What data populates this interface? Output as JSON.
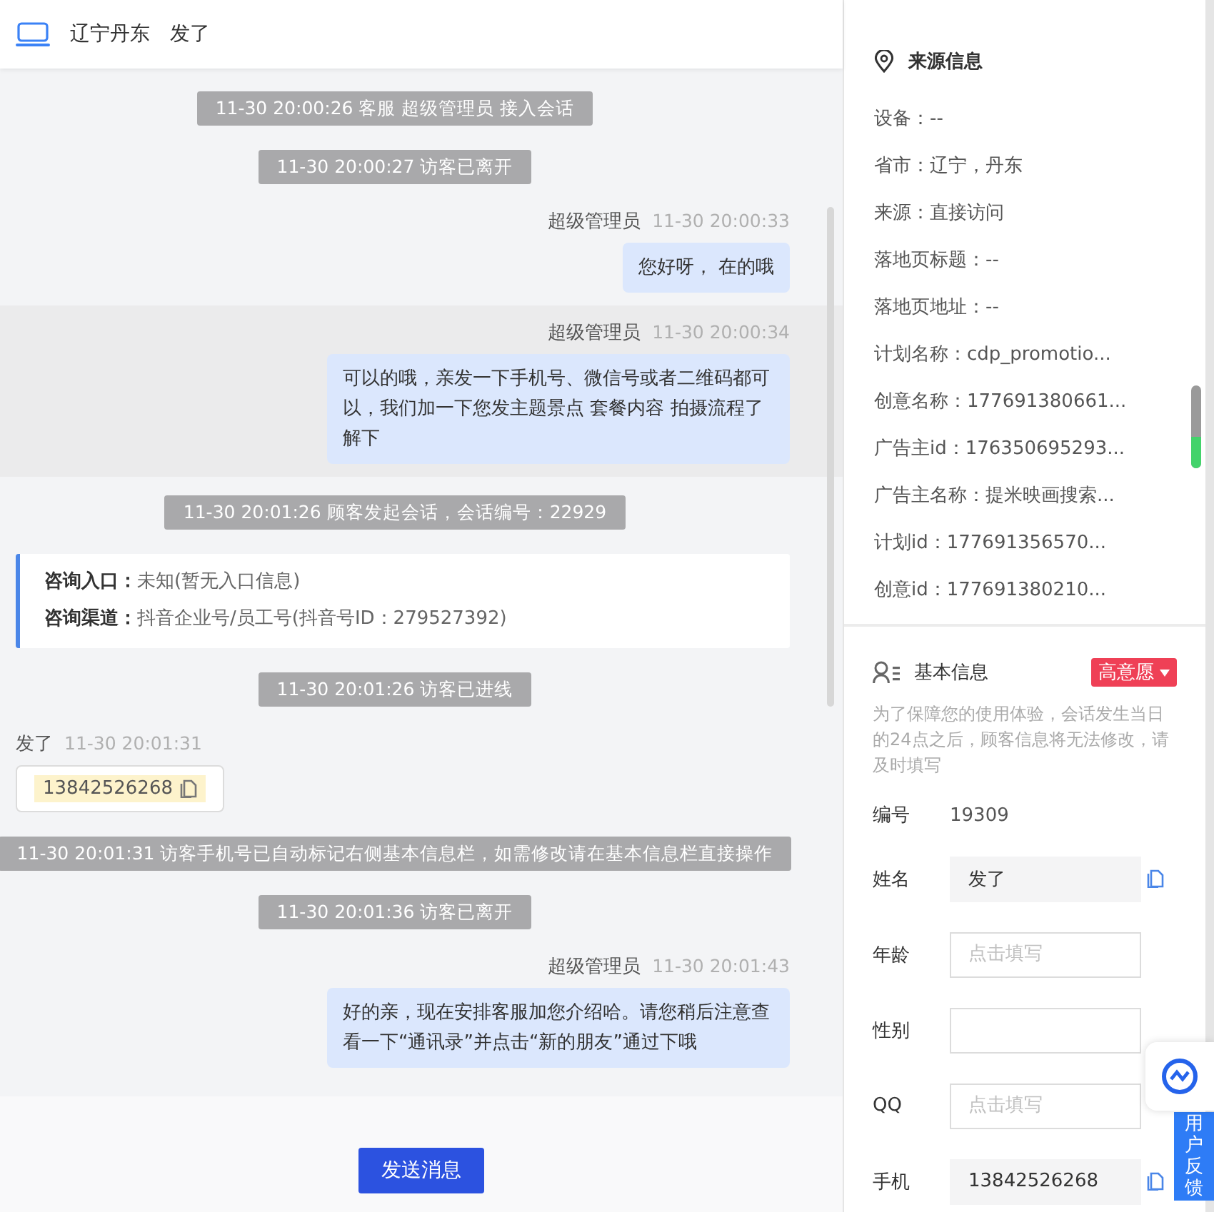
{
  "header": {
    "location": "辽宁丹东",
    "visitor": "发了"
  },
  "messages": [
    {
      "kind": "system",
      "text": "11-30 20:00:26 客服 超级管理员 接入会话"
    },
    {
      "kind": "system",
      "text": "11-30 20:00:27 访客已离开"
    },
    {
      "kind": "agent",
      "sender": "超级管理员",
      "time": "11-30 20:00:33",
      "text": "您好呀， 在的哦",
      "highlighted": false
    },
    {
      "kind": "agent",
      "sender": "超级管理员",
      "time": "11-30 20:00:34",
      "text": "可以的哦，亲发一下手机号、微信号或者二维码都可以，我们加一下您发主题景点 套餐内容 拍摄流程了解下",
      "highlighted": true
    },
    {
      "kind": "system",
      "text": "11-30 20:01:26 顾客发起会话，会话编号：22929"
    },
    {
      "kind": "info",
      "rows": [
        {
          "label": "咨询入口：",
          "value": "未知(暂无入口信息)"
        },
        {
          "label": "咨询渠道：",
          "value": "抖音企业号/员工号(抖音号ID：279527392)"
        }
      ]
    },
    {
      "kind": "system",
      "text": "11-30 20:01:26 访客已进线"
    },
    {
      "kind": "visitor",
      "sender": "发了",
      "time": "11-30 20:01:31",
      "text": "13842526268"
    },
    {
      "kind": "system",
      "text": "11-30 20:01:31 访客手机号已自动标记右侧基本信息栏，如需修改请在基本信息栏直接操作"
    },
    {
      "kind": "system",
      "text": "11-30 20:01:36 访客已离开"
    },
    {
      "kind": "agent",
      "sender": "超级管理员",
      "time": "11-30 20:01:43",
      "text": "好的亲，现在安排客服加您介绍哈。请您稍后注意查看一下“通讯录”并点击“新的朋友”通过下哦",
      "highlighted": false
    }
  ],
  "send_button": "发送消息",
  "source": {
    "title": "来源信息",
    "items": [
      "设备：--",
      "省市：辽宁，丹东",
      "来源：直接访问",
      "落地页标题：--",
      "落地页地址：--",
      "计划名称：cdp_promotio...",
      "创意名称：177691380661...",
      "广告主id：176350695293...",
      "广告主名称：提米映画搜索...",
      "计划id：177691356570...",
      "创意id：177691380210..."
    ]
  },
  "basic": {
    "title": "基本信息",
    "tag": "高意愿",
    "note": "为了保障您的使用体验，会话发生当日的24点之后，顾客信息将无法修改，请及时填写",
    "fields": [
      {
        "kind": "text",
        "label": "编号",
        "value": "19309"
      },
      {
        "kind": "input",
        "label": "姓名",
        "value": "发了",
        "copy": true
      },
      {
        "kind": "input",
        "label": "年龄",
        "placeholder": "点击填写",
        "copy": false
      },
      {
        "kind": "input",
        "label": "性别",
        "copy": false
      },
      {
        "kind": "input",
        "label": "QQ",
        "placeholder": "点击填写",
        "copy": false
      },
      {
        "kind": "input",
        "label": "手机",
        "value": "13842526268",
        "copy": true
      }
    ]
  },
  "feedback": "用户反馈"
}
